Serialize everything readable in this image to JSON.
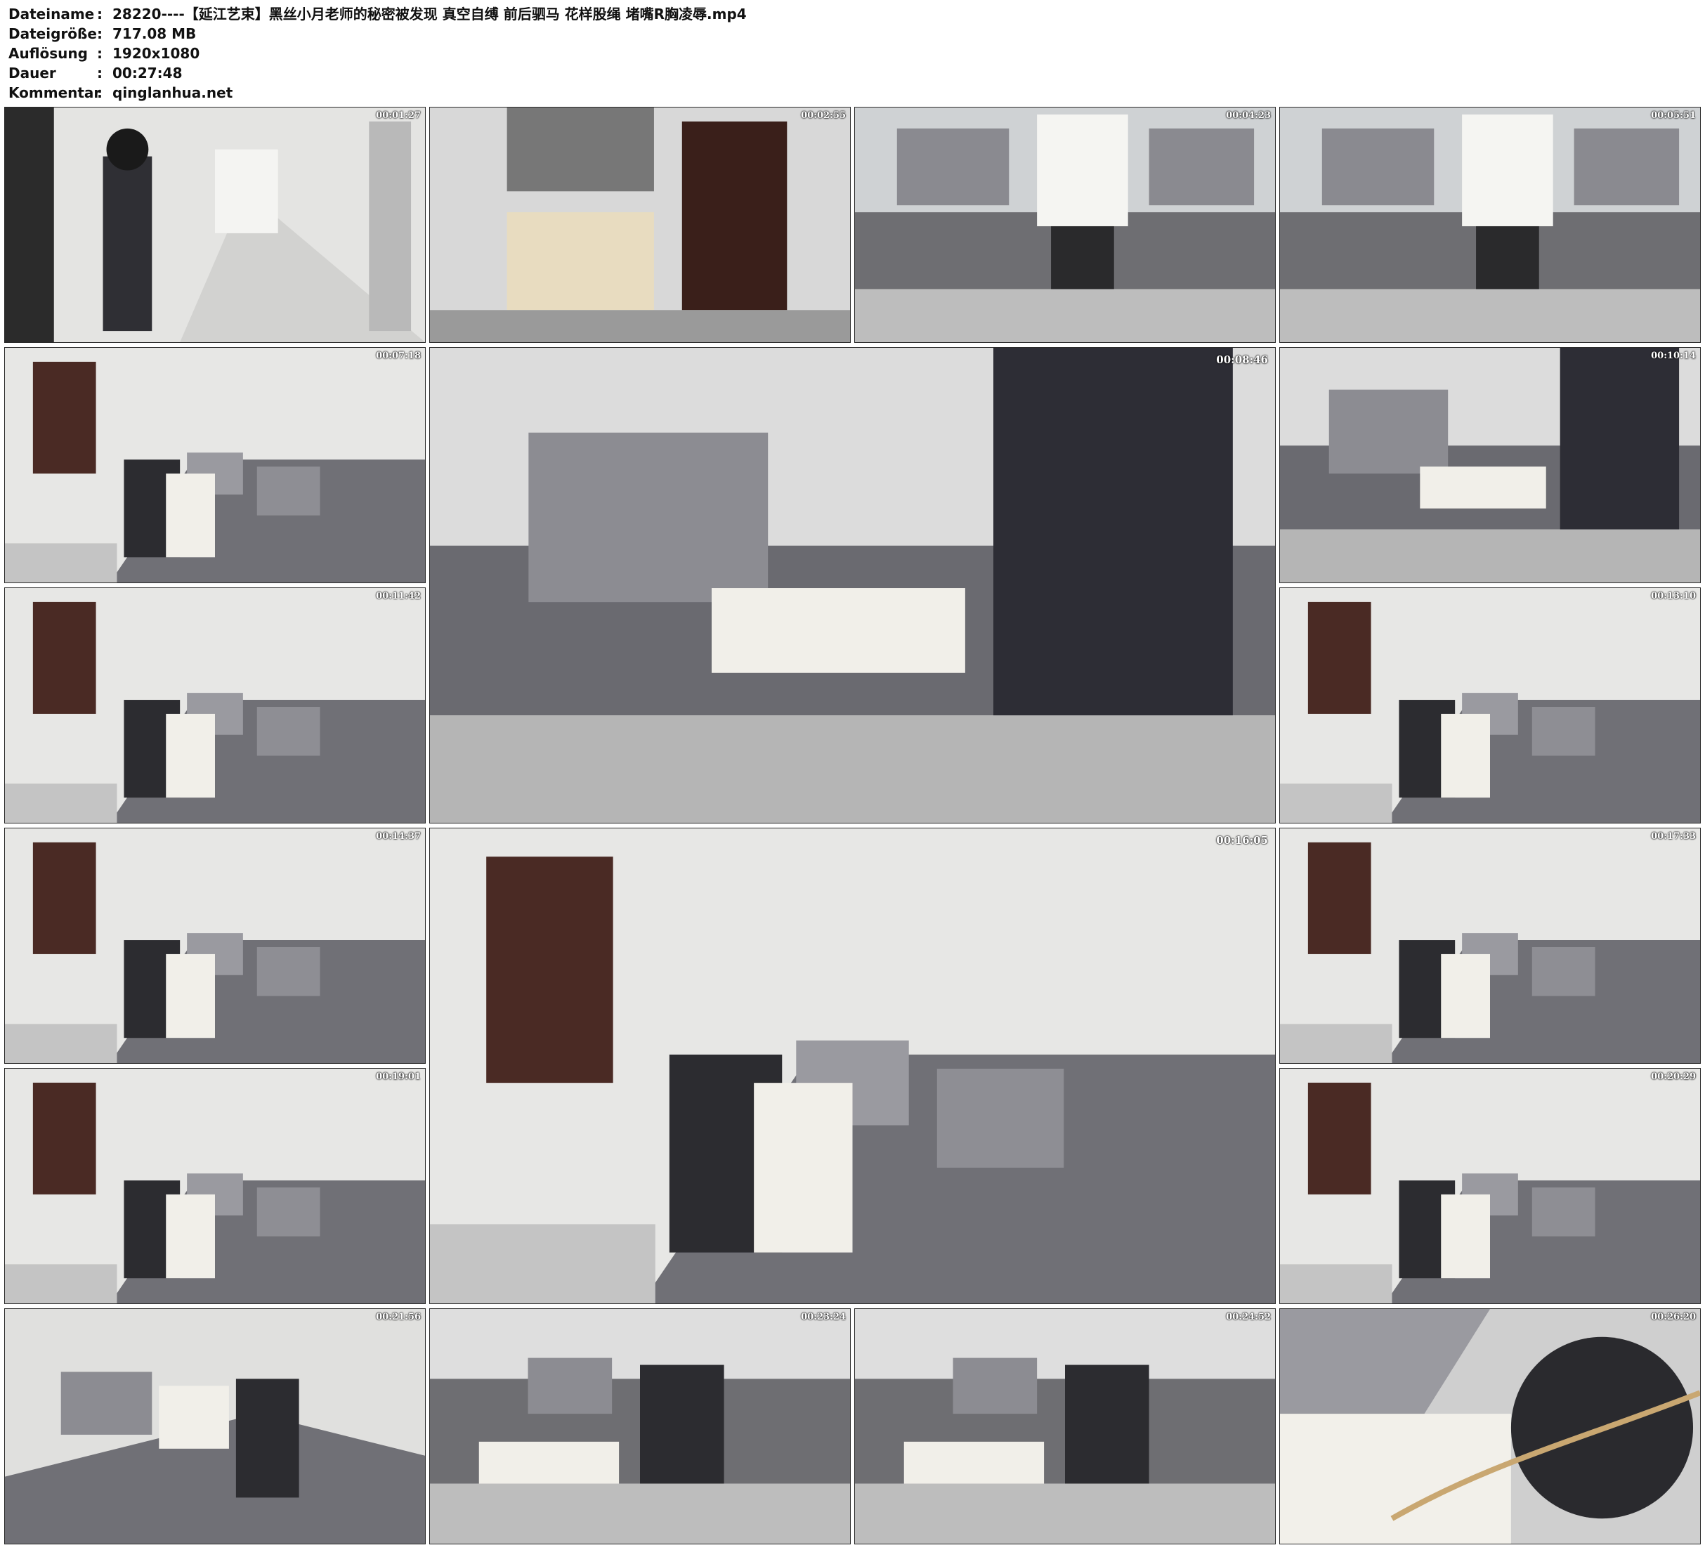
{
  "info": [
    {
      "key": "Dateiname",
      "sep": ":",
      "value": "28220----【延江艺束】黑丝小月老师的秘密被发现 真空自缚 前后驷马 花样股绳 堵嘴R胸凌辱.mp4"
    },
    {
      "key": "Dateigröße",
      "sep": ":",
      "value": "717.08 MB"
    },
    {
      "key": "Auflösung",
      "sep": ":",
      "value": "1920x1080"
    },
    {
      "key": "Dauer",
      "sep": ":",
      "value": "00:27:48"
    },
    {
      "key": "Kommentar",
      "sep": ":",
      "value": "qinglanhua.net"
    }
  ],
  "thumbnails": [
    {
      "timestamp": "00:01:27",
      "scene": "hallway"
    },
    {
      "timestamp": "00:02:55",
      "scene": "entry"
    },
    {
      "timestamp": "00:04:23",
      "scene": "sofa-sit"
    },
    {
      "timestamp": "00:05:51",
      "scene": "sofa-sit"
    },
    {
      "timestamp": "00:07:18",
      "scene": "living-room"
    },
    {
      "timestamp": "00:08:46",
      "scene": "sofa-lie"
    },
    {
      "timestamp": "00:10:14",
      "scene": "sofa-lie"
    },
    {
      "timestamp": "00:11:42",
      "scene": "living-room"
    },
    {
      "timestamp": "00:13:10",
      "scene": "living-room"
    },
    {
      "timestamp": "00:14:37",
      "scene": "living-room"
    },
    {
      "timestamp": "00:16:05",
      "scene": "living-room"
    },
    {
      "timestamp": "00:17:33",
      "scene": "living-room"
    },
    {
      "timestamp": "00:19:01",
      "scene": "living-room"
    },
    {
      "timestamp": "00:20:29",
      "scene": "living-room"
    },
    {
      "timestamp": "00:21:56",
      "scene": "sofa-side"
    },
    {
      "timestamp": "00:23:24",
      "scene": "sofa-front"
    },
    {
      "timestamp": "00:24:52",
      "scene": "sofa-front"
    },
    {
      "timestamp": "00:26:20",
      "scene": "closeup"
    }
  ]
}
